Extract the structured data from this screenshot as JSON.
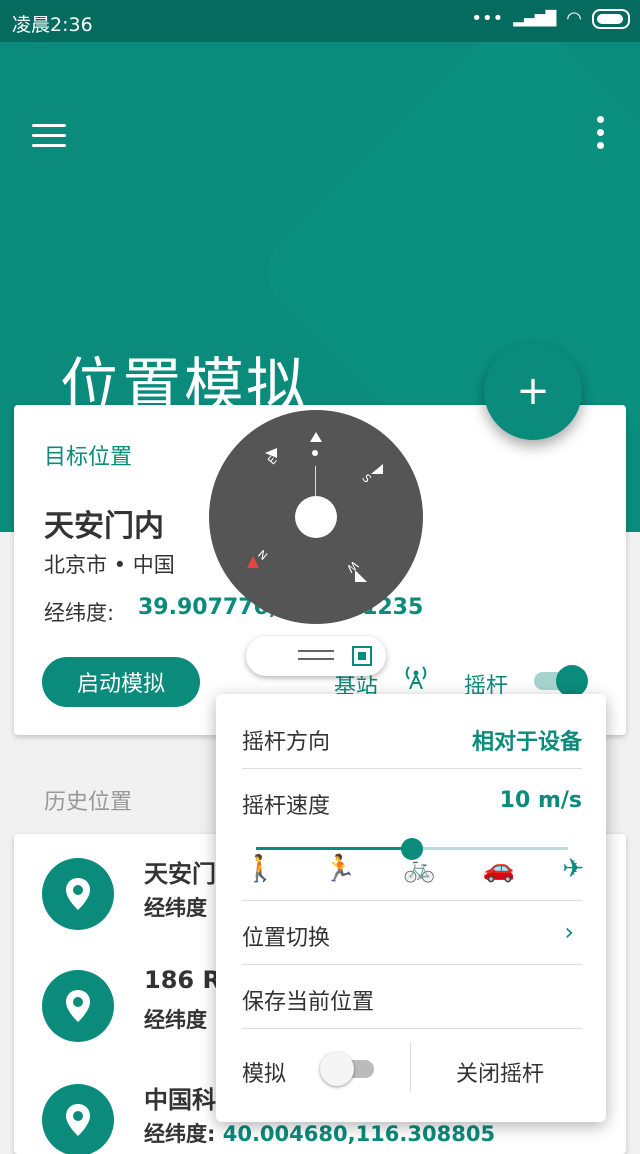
{
  "status": {
    "time": "凌晨2:36",
    "dots": "•••",
    "signal": "▂▄▆█",
    "wifi": "◠"
  },
  "header": {
    "title": "位置模拟",
    "fab": "+"
  },
  "target": {
    "label": "目标位置",
    "place": "天安门内",
    "region": "北京市 • 中国",
    "coord_label": "经纬度:",
    "coord_value": "39.907776,116.391235",
    "start_button": "启动模拟",
    "base_station": "基站",
    "joystick": "摇杆",
    "joystick_on": true
  },
  "compass": {
    "n": "N",
    "s": "S",
    "e": "E",
    "w": "W"
  },
  "history": {
    "label": "历史位置",
    "items": [
      {
        "name": "天安门",
        "coord_label": "经纬度",
        "coord_value": ""
      },
      {
        "name": "186 R",
        "coord_label": "经纬度",
        "coord_value": ""
      },
      {
        "name": "中国科",
        "coord_label": "经纬度:",
        "coord_value": "40.004680,116.308805"
      }
    ]
  },
  "popup": {
    "direction_label": "摇杆方向",
    "direction_value": "相对于设备",
    "speed_label": "摇杆速度",
    "speed_value": "10 m/s",
    "speed_level": 0.5,
    "speed_icons": [
      "🚶",
      "🏃",
      "🚲",
      "🚗",
      "✈"
    ],
    "switch_location": "位置切换",
    "chevron": "›",
    "save_location": "保存当前位置",
    "simulate_label": "模拟",
    "simulate_on": false,
    "close_joystick": "关闭摇杆"
  },
  "colors": {
    "accent": "#0a8b7b",
    "status_bar": "#066b5f"
  }
}
